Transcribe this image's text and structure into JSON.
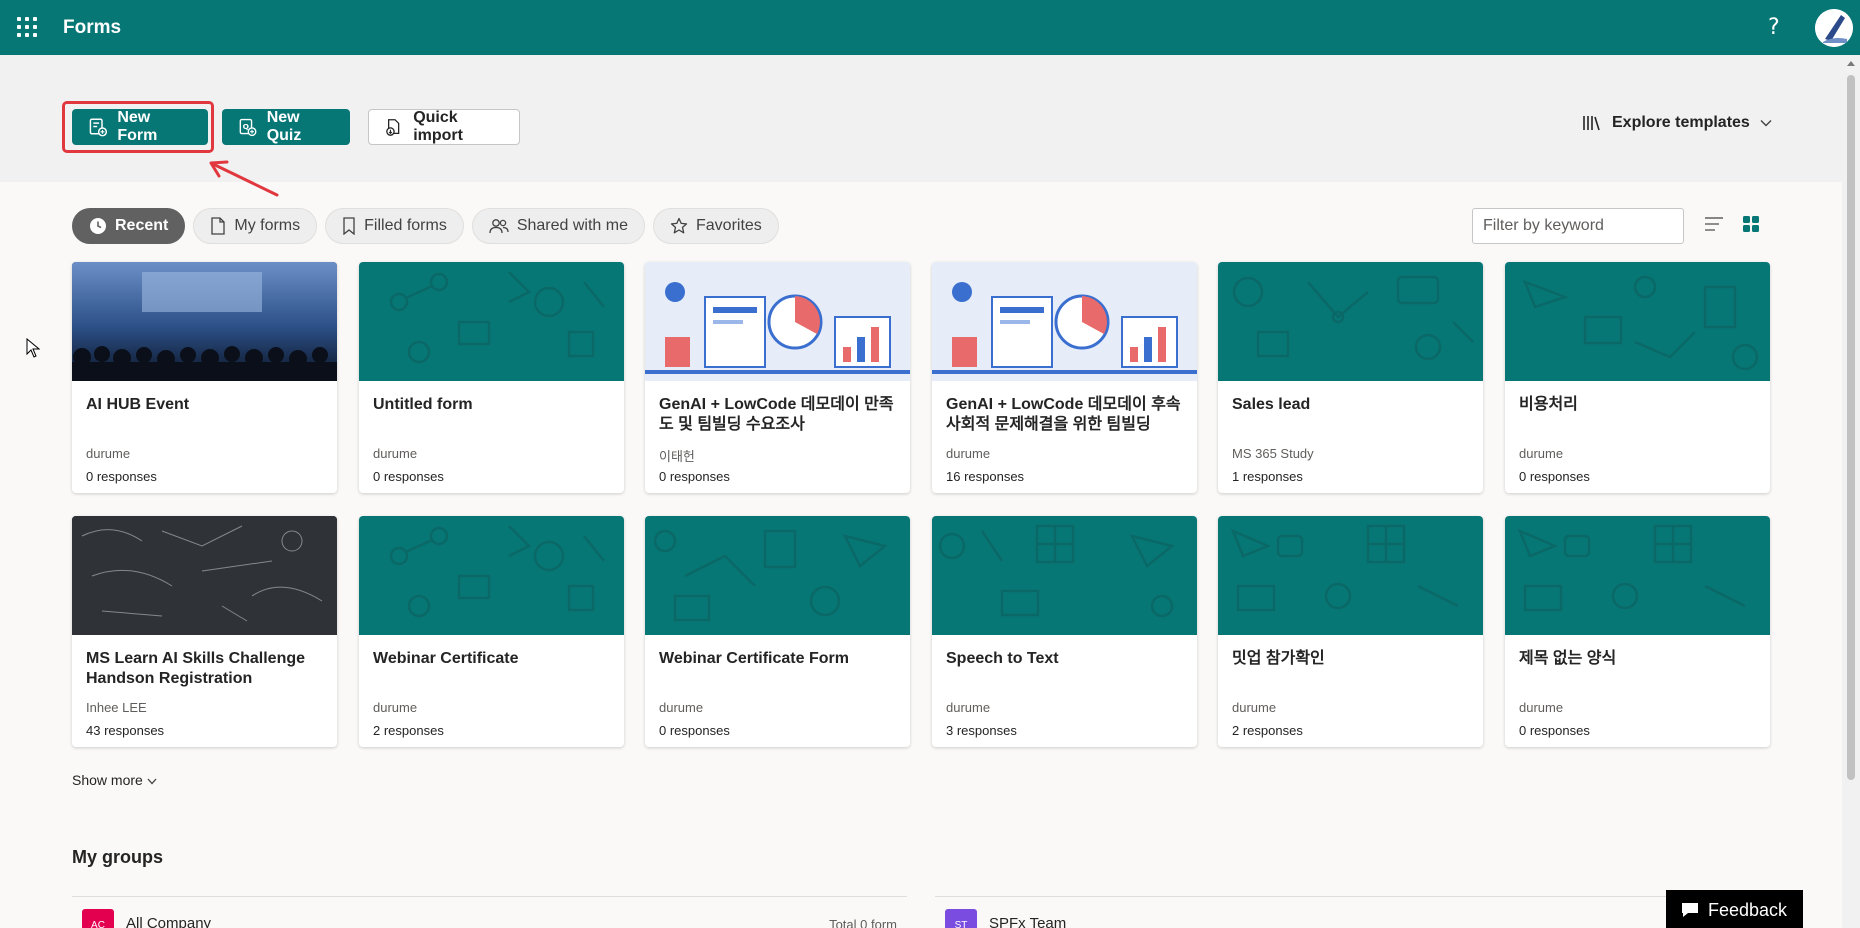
{
  "app": {
    "title": "Forms",
    "help": "?"
  },
  "actions": {
    "new_form": "New Form",
    "new_quiz": "New Quiz",
    "quick_import": "Quick import",
    "explore_templates": "Explore templates"
  },
  "tabs": [
    {
      "label": "Recent",
      "active": true
    },
    {
      "label": "My forms",
      "active": false
    },
    {
      "label": "Filled forms",
      "active": false
    },
    {
      "label": "Shared with me",
      "active": false
    },
    {
      "label": "Favorites",
      "active": false
    }
  ],
  "filter": {
    "placeholder": "Filter by keyword"
  },
  "cards": [
    {
      "title": "AI HUB Event",
      "owner": "durume",
      "responses": "0 responses",
      "thumb": "photo-event"
    },
    {
      "title": "Untitled form",
      "owner": "durume",
      "responses": "0 responses",
      "thumb": "teal-pattern"
    },
    {
      "title": "GenAI + LowCode 데모데이 만족도 및 팀빌딩 수요조사",
      "owner": "이태헌",
      "responses": "0 responses",
      "thumb": "illustration"
    },
    {
      "title": "GenAI + LowCode 데모데이 후속 사회적 문제해결을 위한 팀빌딩",
      "owner": "durume",
      "responses": "16 responses",
      "thumb": "illustration"
    },
    {
      "title": "Sales lead",
      "owner": "MS 365 Study",
      "responses": "1 responses",
      "thumb": "teal-pattern"
    },
    {
      "title": "비용처리",
      "owner": "durume",
      "responses": "0 responses",
      "thumb": "teal-pattern"
    },
    {
      "title": "MS Learn AI Skills Challenge Handson Registration",
      "owner": "Inhee LEE",
      "responses": "43 responses",
      "thumb": "photo-chalkboard"
    },
    {
      "title": "Webinar Certificate",
      "owner": "durume",
      "responses": "2 responses",
      "thumb": "teal-pattern"
    },
    {
      "title": "Webinar Certificate Form",
      "owner": "durume",
      "responses": "0 responses",
      "thumb": "teal-pattern"
    },
    {
      "title": "Speech to Text",
      "owner": "durume",
      "responses": "3 responses",
      "thumb": "teal-pattern"
    },
    {
      "title": "밋업 참가확인",
      "owner": "durume",
      "responses": "2 responses",
      "thumb": "teal-pattern"
    },
    {
      "title": "제목 없는 양식",
      "owner": "durume",
      "responses": "0 responses",
      "thumb": "teal-pattern"
    }
  ],
  "show_more": "Show more",
  "groups": {
    "title": "My groups",
    "items": [
      {
        "badge": "AC",
        "name": "All Company",
        "total": "Total 0 form",
        "color": "#e3004f"
      },
      {
        "badge": "ST",
        "name": "SPFx Team",
        "total": "",
        "color": "#7a4ce0"
      }
    ]
  },
  "feedback": "Feedback",
  "colors": {
    "brand": "#077776",
    "highlight": "#e0383e"
  }
}
